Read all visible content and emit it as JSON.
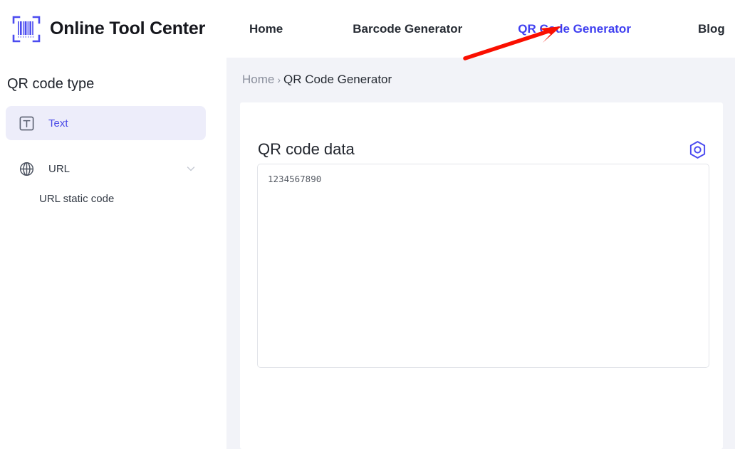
{
  "brand": {
    "name": "Online Tool Center",
    "logo_icon": "barcode-scanner-icon",
    "logo_color": "#4b4bf0"
  },
  "nav": {
    "items": [
      {
        "label": "Home",
        "active": false
      },
      {
        "label": "Barcode Generator",
        "active": false
      },
      {
        "label": "QR Code Generator",
        "active": true
      },
      {
        "label": "Blog",
        "active": false
      }
    ],
    "active_color": "#3f3ff0",
    "default_color": "#262b33"
  },
  "annotation": {
    "type": "red-arrow",
    "color": "#fa0f00",
    "points_to": "QR Code Generator"
  },
  "sidebar": {
    "title": "QR code type",
    "items": [
      {
        "label": "Text",
        "icon": "text-box-icon",
        "active": true,
        "has_chevron": false
      },
      {
        "label": "URL",
        "icon": "globe-icon",
        "active": false,
        "has_chevron": true,
        "chevron_icon": "chevron-down-icon"
      }
    ],
    "subitems": [
      {
        "label": "URL static code"
      }
    ],
    "active_bg": "#ededfa",
    "active_text": "#4b4be6"
  },
  "breadcrumb": {
    "home": "Home",
    "separator": "›",
    "current": "QR Code Generator"
  },
  "card": {
    "title": "QR code data",
    "config_icon": "hexagon-settings-icon",
    "config_icon_color": "#4b4bf0",
    "textarea": {
      "value": "1234567890",
      "placeholder": ""
    }
  },
  "colors": {
    "page_bg": "#f2f3f8",
    "card_bg": "#ffffff",
    "accent": "#4b4bf0",
    "text_dark": "#21252d",
    "text_muted": "#8a8f9c"
  }
}
